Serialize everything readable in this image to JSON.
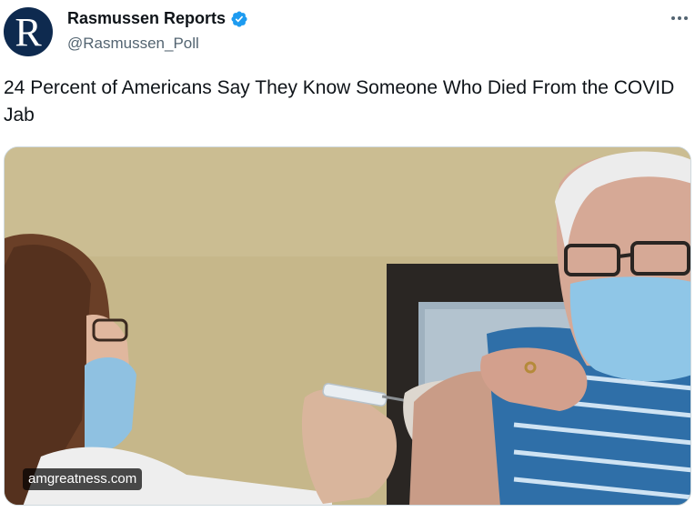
{
  "author": {
    "display_name": "Rasmussen Reports",
    "handle": "@Rasmussen_Poll",
    "avatar_letter": "R",
    "verified": true,
    "verified_color": "#1d9bf0",
    "avatar_color": "#0e2a4f"
  },
  "more_icon": "more-dots-icon",
  "tweet": {
    "text": "24 Percent of Americans Say They Know Someone Who Died From the COVID Jab"
  },
  "media": {
    "source_label": "amgreatness.com"
  }
}
